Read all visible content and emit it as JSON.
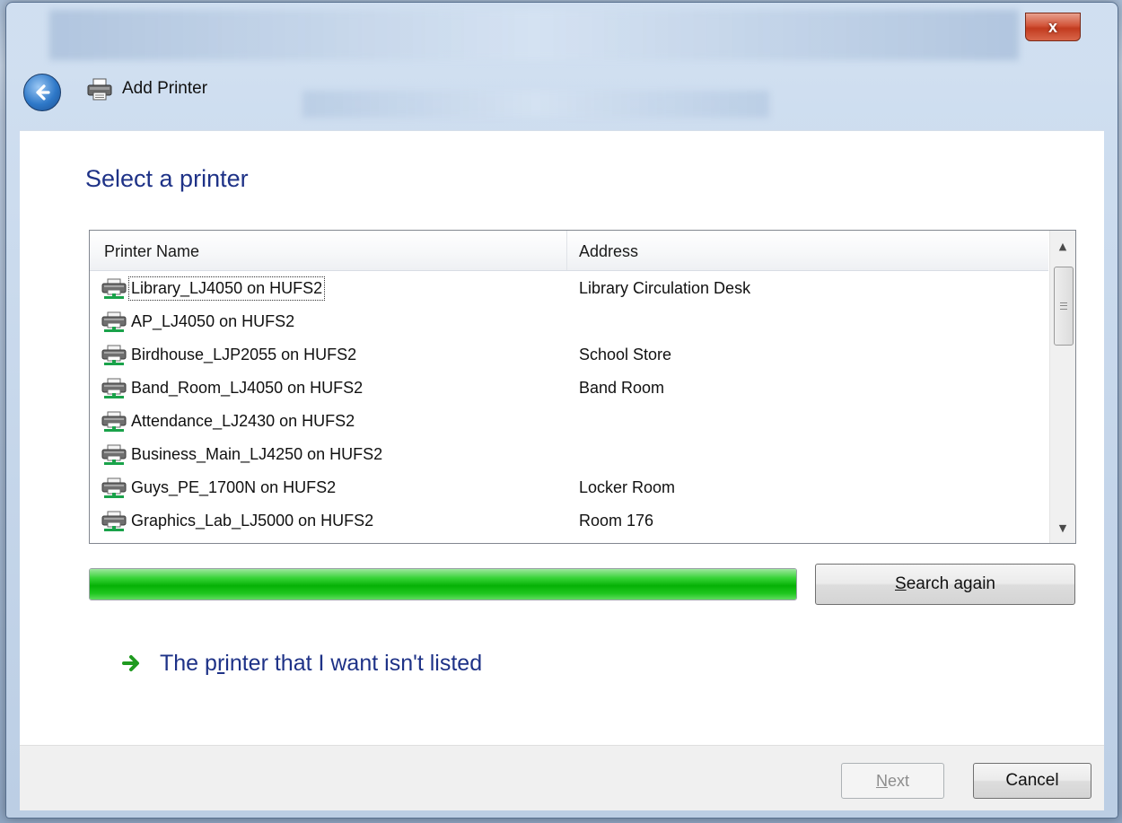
{
  "window": {
    "title": "Add Printer",
    "close_glyph": "x"
  },
  "dialog": {
    "heading": "Select a printer",
    "columns": {
      "name": "Printer Name",
      "address": "Address"
    },
    "printers": [
      {
        "name": "Library_LJ4050 on HUFS2",
        "address": "Library Circulation Desk"
      },
      {
        "name": "AP_LJ4050 on HUFS2",
        "address": ""
      },
      {
        "name": "Birdhouse_LJP2055 on HUFS2",
        "address": "School Store"
      },
      {
        "name": "Band_Room_LJ4050 on HUFS2",
        "address": "Band Room"
      },
      {
        "name": "Attendance_LJ2430 on HUFS2",
        "address": ""
      },
      {
        "name": "Business_Main_LJ4250 on HUFS2",
        "address": ""
      },
      {
        "name": "Guys_PE_1700N on HUFS2",
        "address": "Locker Room"
      },
      {
        "name": "Graphics_Lab_LJ5000 on HUFS2",
        "address": "Room 176"
      }
    ],
    "progress_fraction": 1.0,
    "search_again": {
      "pre": "",
      "accel": "S",
      "post": "earch again"
    },
    "not_listed": {
      "pre": "The p",
      "accel": "r",
      "post": "inter that I want isn't listed"
    }
  },
  "footer": {
    "next": {
      "pre": "",
      "accel": "N",
      "post": "ext"
    },
    "cancel": "Cancel"
  },
  "icons": {
    "back": "back-arrow-icon",
    "printer": "printer-icon",
    "network_printer": "network-printer-icon",
    "link": "green-arrow-icon"
  },
  "colors": {
    "heading": "#1e3287",
    "progress": "#06b106",
    "close": "#c23b1f"
  }
}
